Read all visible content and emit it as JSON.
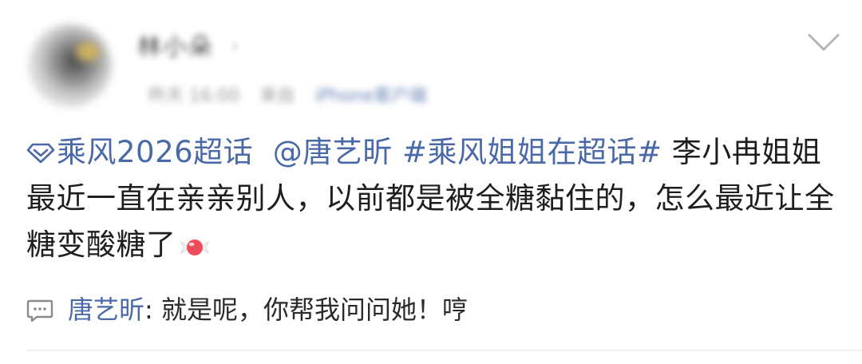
{
  "post": {
    "author_name": "林小朵",
    "author_caret": "›",
    "meta_time": "昨天 16:00",
    "meta_from": "来自",
    "meta_source": "iPhone客户端",
    "supertopic_link": "乘风2026超话",
    "mention": "@唐艺昕",
    "hashtag": "#乘风姐姐在超话#",
    "body_text": " 李小冉姐姐最近一直在亲亲别人，以前都是被全糖黏住的，怎么最近让全糖变酸糖了"
  },
  "comment": {
    "author": "唐艺昕",
    "separator": ": ",
    "text": "就是呢，你帮我问问她！哼"
  },
  "icons": {
    "supertopic": "diamond-supertopic-icon",
    "candy": "candy-emoji-icon",
    "comment": "comment-bubble-icon",
    "more": "chevron-down-icon"
  },
  "colors": {
    "link": "#4a69a8",
    "text": "#1e1e1e",
    "meta": "#9a9a9a"
  }
}
